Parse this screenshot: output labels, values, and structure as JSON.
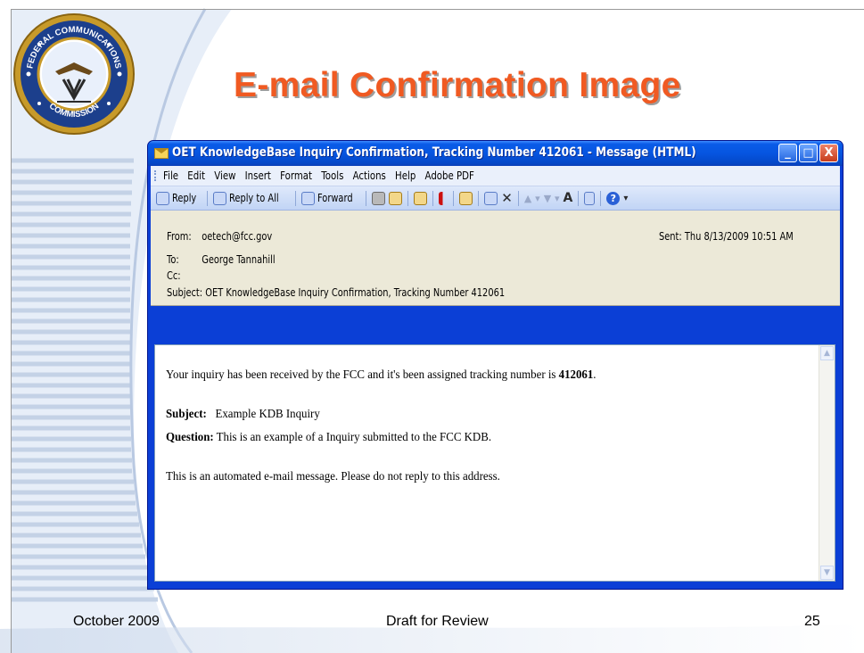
{
  "slide": {
    "title": "E-mail Confirmation Image",
    "footer_left": "October 2009",
    "footer_center": "Draft for Review",
    "page_number": "25",
    "seal_text_top": "FEDERAL COMMUNICATIONS",
    "seal_text_bottom": "COMMISSION"
  },
  "window": {
    "title": "OET KnowledgeBase Inquiry Confirmation, Tracking Number 412061 - Message (HTML)",
    "controls": {
      "minimize": "_",
      "maximize": "□",
      "close": "X"
    },
    "menu": [
      "File",
      "Edit",
      "View",
      "Insert",
      "Format",
      "Tools",
      "Actions",
      "Help",
      "Adobe PDF"
    ],
    "toolbar": {
      "reply": "Reply",
      "reply_all": "Reply to All",
      "forward": "Forward"
    }
  },
  "message": {
    "from_label": "From:",
    "from": "oetech@fcc.gov",
    "to_label": "To:",
    "to": "George Tannahill",
    "cc_label": "Cc:",
    "cc": "",
    "subject_label": "Subject:",
    "subject": "OET KnowledgeBase Inquiry Confirmation, Tracking Number 412061",
    "sent_label": "Sent:",
    "sent": "Thu 8/13/2009 10:51 AM",
    "body": {
      "intro": "Your inquiry has been received by the FCC and it's been assigned tracking number is",
      "tracking_number": "412061",
      "intro_end": ".",
      "subject_label": "Subject:",
      "subject_value": "Example KDB Inquiry",
      "question_label": "Question:",
      "question_value": "This is an example of a Inquiry submitted to the FCC KDB.",
      "closing": "This is an automated e-mail message. Please do not reply to this address."
    }
  },
  "colors": {
    "title_orange": "#f05a22",
    "xp_blue": "#0655e0",
    "header_beige": "#ece9d8"
  }
}
